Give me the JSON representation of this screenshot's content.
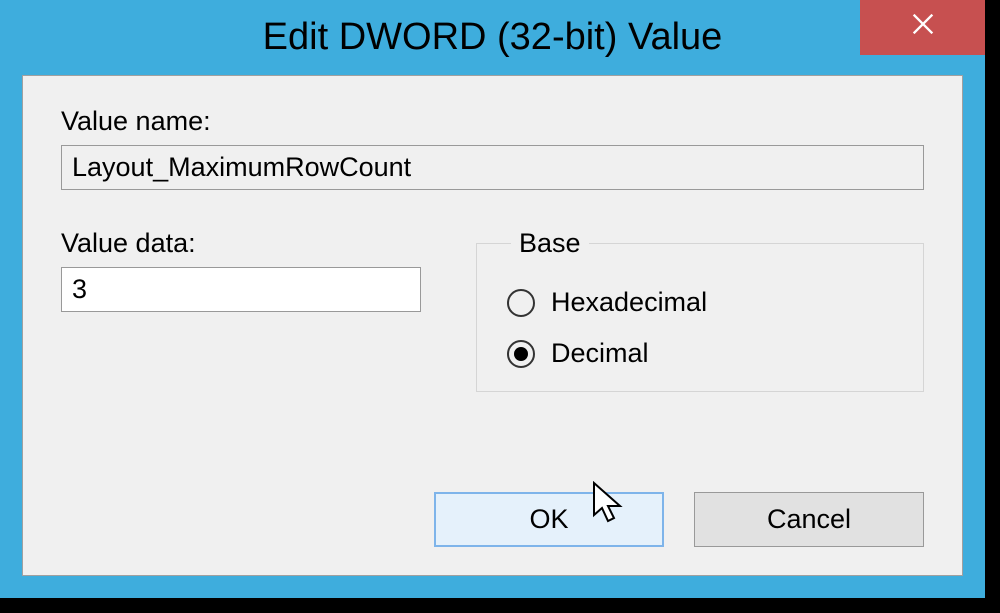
{
  "title": "Edit DWORD (32-bit) Value",
  "valueName": {
    "label": "Value name:",
    "value": "Layout_MaximumRowCount"
  },
  "valueData": {
    "label": "Value data:",
    "value": "3"
  },
  "base": {
    "legend": "Base",
    "options": {
      "hex": "Hexadecimal",
      "dec": "Decimal"
    },
    "selected": "dec"
  },
  "buttons": {
    "ok": "OK",
    "cancel": "Cancel"
  }
}
